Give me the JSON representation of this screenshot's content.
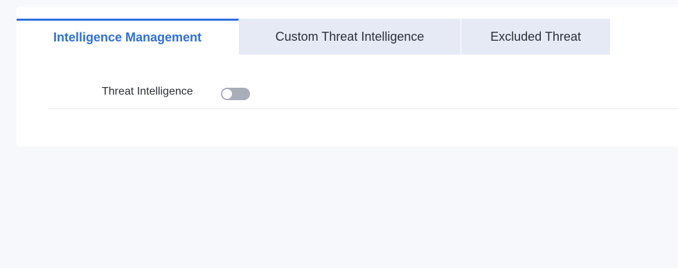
{
  "tabs": [
    {
      "label": "Intelligence Management",
      "active": true
    },
    {
      "label": "Custom Threat Intelligence",
      "active": false
    },
    {
      "label": "Excluded Threat",
      "active": false
    }
  ],
  "settings": {
    "threat_intelligence": {
      "label": "Threat Intelligence",
      "enabled": false
    }
  },
  "colors": {
    "accent": "#2f6fe0",
    "tab_inactive_bg": "#e6eaf5",
    "toggle_off": "#a9adb8",
    "page_bg": "#f7f8fc"
  }
}
